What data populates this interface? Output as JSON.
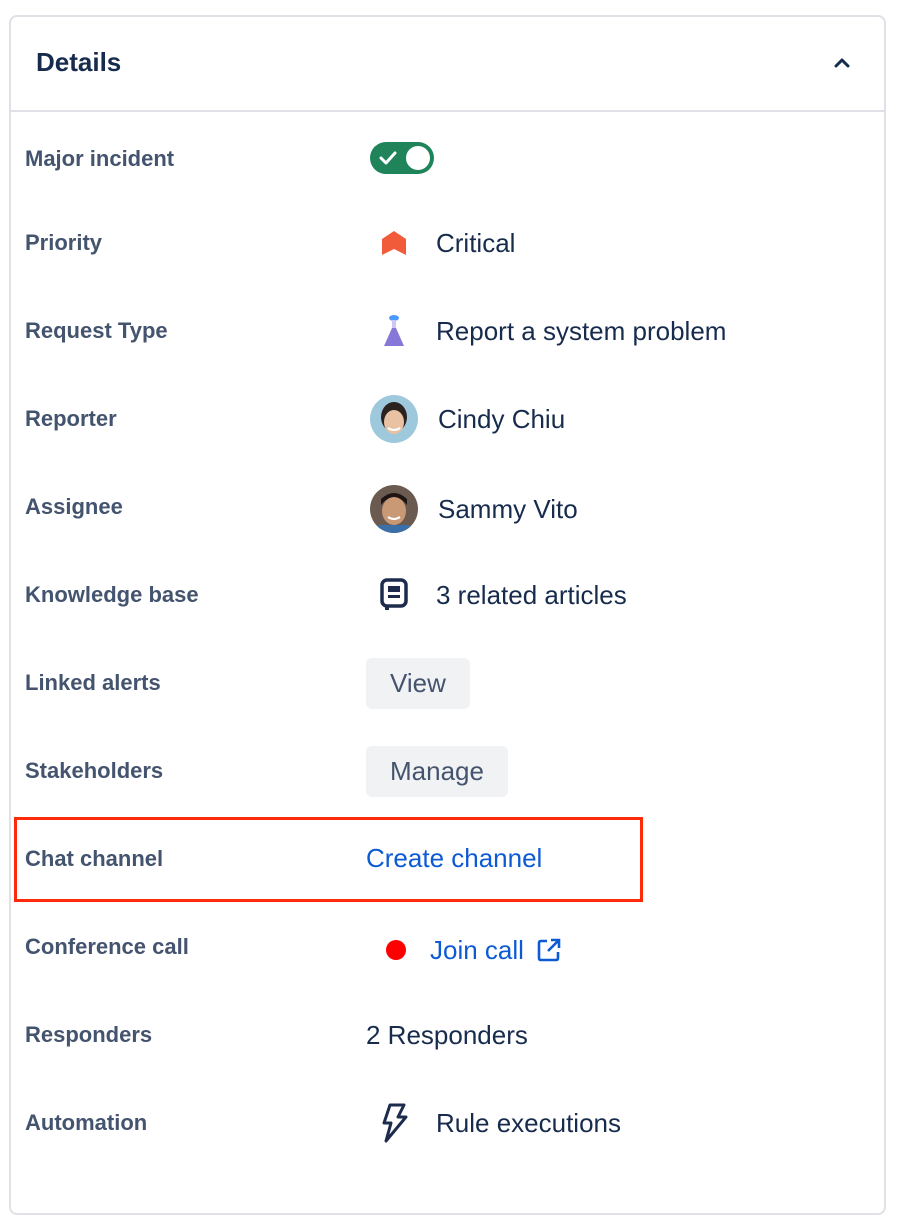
{
  "header": {
    "title": "Details",
    "collapse_icon": "chevron-up-icon"
  },
  "fields": {
    "major_incident": {
      "label": "Major incident",
      "toggle_on": true
    },
    "priority": {
      "label": "Priority",
      "value": "Critical",
      "icon": "priority-critical-icon",
      "color": "#f15b3a"
    },
    "request_type": {
      "label": "Request Type",
      "value": "Report a system problem",
      "icon": "flask-icon"
    },
    "reporter": {
      "label": "Reporter",
      "value": "Cindy Chiu"
    },
    "assignee": {
      "label": "Assignee",
      "value": "Sammy Vito"
    },
    "knowledge_base": {
      "label": "Knowledge base",
      "value": "3 related articles",
      "icon": "book-icon"
    },
    "linked_alerts": {
      "label": "Linked alerts",
      "button": "View"
    },
    "stakeholders": {
      "label": "Stakeholders",
      "button": "Manage"
    },
    "chat_channel": {
      "label": "Chat channel",
      "link": "Create channel"
    },
    "conference_call": {
      "label": "Conference call",
      "link": "Join call",
      "status_color": "#ff0000"
    },
    "responders": {
      "label": "Responders",
      "value": "2 Responders"
    },
    "automation": {
      "label": "Automation",
      "value": "Rule executions",
      "icon": "lightning-icon"
    }
  },
  "colors": {
    "accent_link": "#0c5ad4",
    "toggle_on": "#1f845a",
    "highlight": "#ff2a0a"
  }
}
